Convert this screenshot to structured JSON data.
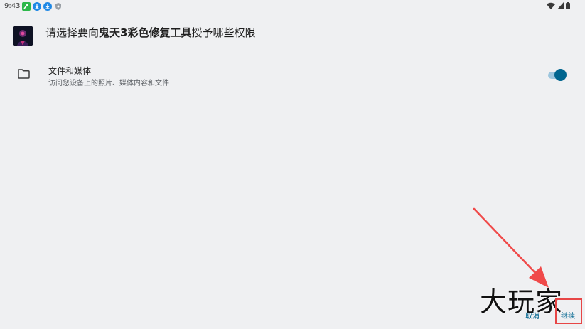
{
  "status_bar": {
    "time": "9:43",
    "notification_icons": [
      "app-notification-icon",
      "download-icon",
      "download-icon",
      "shield-icon"
    ],
    "system_icons": [
      "wifi-icon",
      "signal-icon",
      "battery-icon"
    ]
  },
  "header": {
    "title_prefix": "请选择要向",
    "app_name": "鬼天3彩色修复工具",
    "title_suffix": "授予哪些权限"
  },
  "permission": {
    "icon": "folder-icon",
    "title": "文件和媒体",
    "description": "访问您设备上的照片、媒体内容和文件",
    "enabled": true
  },
  "buttons": {
    "cancel": "取消",
    "continue": "继续"
  },
  "watermark": "大玩家",
  "colors": {
    "background": "#eff0f2",
    "accent": "#00658f",
    "toggle_track": "#9dc6de",
    "annotation": "#e74646"
  }
}
